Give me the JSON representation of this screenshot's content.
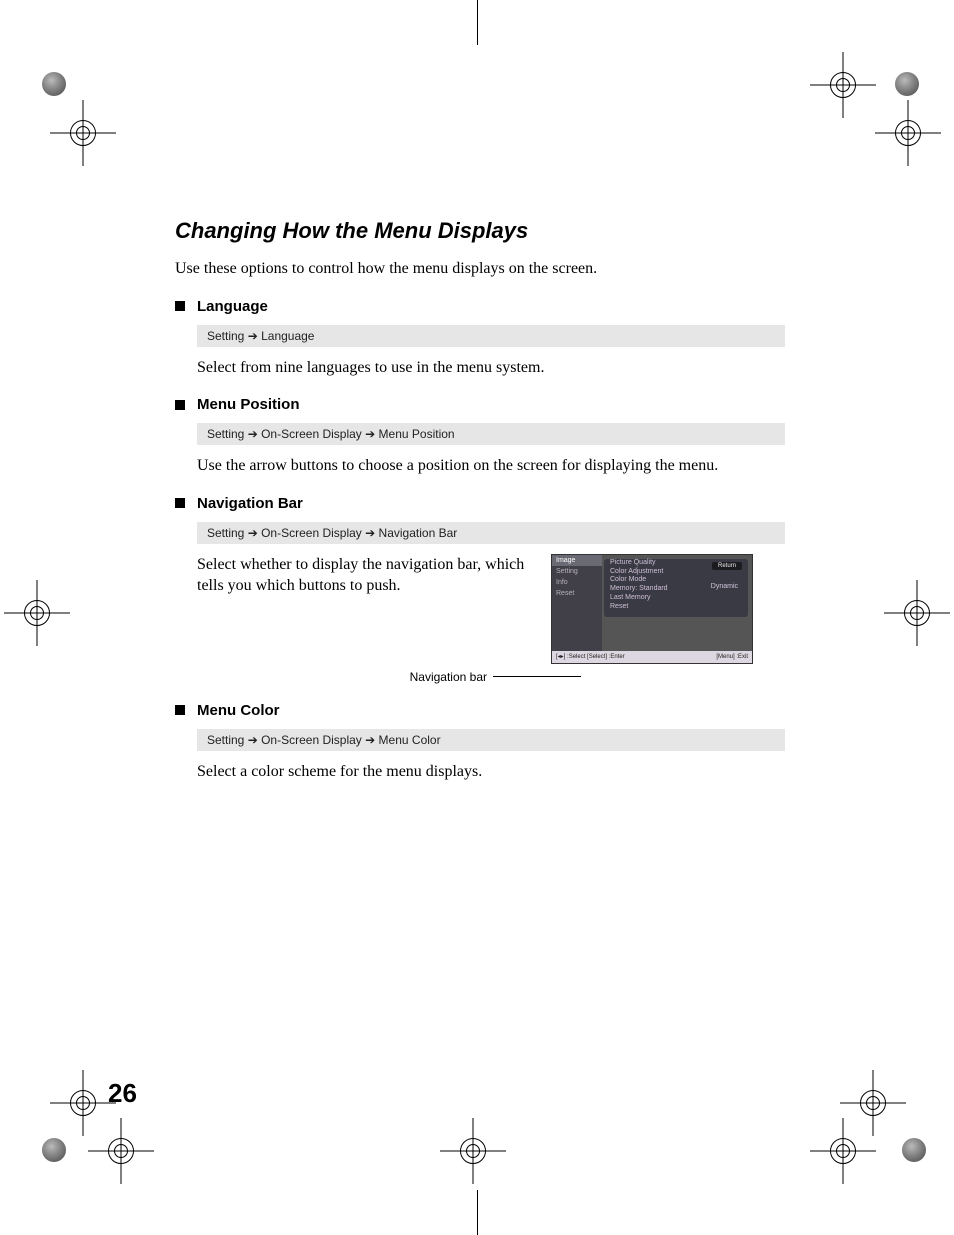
{
  "title": "Changing How the Menu Displays",
  "intro": "Use these options to control how the menu displays on the screen.",
  "arrow": " ➔ ",
  "items": [
    {
      "heading": "Language",
      "path": [
        "Setting",
        "Language"
      ],
      "desc": "Select from nine languages to use in the menu system."
    },
    {
      "heading": "Menu Position",
      "path": [
        "Setting",
        "On-Screen Display",
        "Menu Position"
      ],
      "desc": "Use the arrow buttons to choose a position on the screen for displaying the menu."
    },
    {
      "heading": "Navigation Bar",
      "path": [
        "Setting",
        "On-Screen Display",
        "Navigation Bar"
      ],
      "desc": "Select whether to display the navigation bar, which tells you which buttons to push."
    },
    {
      "heading": "Menu Color",
      "path": [
        "Setting",
        "On-Screen Display",
        "Menu Color"
      ],
      "desc": "Select a color scheme for the menu displays."
    }
  ],
  "callout_label": "Navigation bar",
  "screenshot": {
    "sidebar": [
      "Image",
      "Setting",
      "Info",
      "Reset"
    ],
    "return": "Return",
    "panel_lines": [
      "Picture Quality",
      "Color Adjustment",
      "Color Mode",
      "Memory: Standard",
      "Last Memory",
      "Reset"
    ],
    "value": "Dynamic",
    "nav_left": "[◂▸] :Select  [Select] :Enter",
    "nav_right": "[Menu] :Exit"
  },
  "page_number": "26"
}
